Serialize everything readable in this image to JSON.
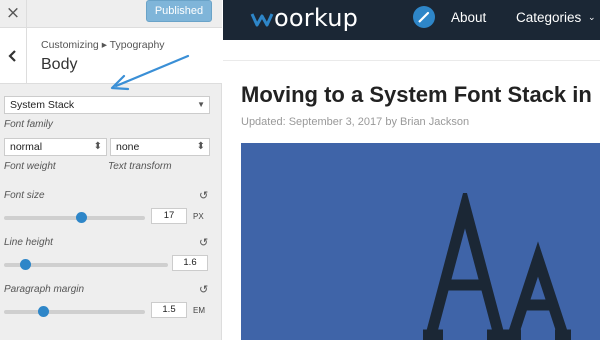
{
  "customizer": {
    "close_glyph": "×",
    "publish_label": "Published",
    "breadcrumb": "Customizing ▸ Typography",
    "section_title": "Body",
    "font_family": {
      "value": "System Stack",
      "label": "Font family"
    },
    "font_weight": {
      "value": "normal",
      "label": "Font weight"
    },
    "text_transform": {
      "value": "none",
      "label": "Text transform"
    },
    "font_size": {
      "label": "Font size",
      "value": "17",
      "unit": "PX",
      "slider_fraction": 0.55
    },
    "line_height": {
      "label": "Line height",
      "value": "1.6",
      "slider_fraction": 0.13
    },
    "paragraph_margin": {
      "label": "Paragraph margin",
      "value": "1.5",
      "unit": "EM",
      "slider_fraction": 0.28
    },
    "reset_glyph": "↺"
  },
  "site": {
    "logo": "oorkup",
    "nav": [
      "About",
      "Categories"
    ],
    "caret_glyph": "⌄",
    "article": {
      "title": "Moving to a System Font Stack in",
      "meta": "Updated: September 3, 2017 by Brian Jackson"
    },
    "colors": {
      "header": "#1b2735",
      "accent": "#2e86c8",
      "hero": "#3f64a8",
      "glyph": "#1b2735"
    }
  }
}
